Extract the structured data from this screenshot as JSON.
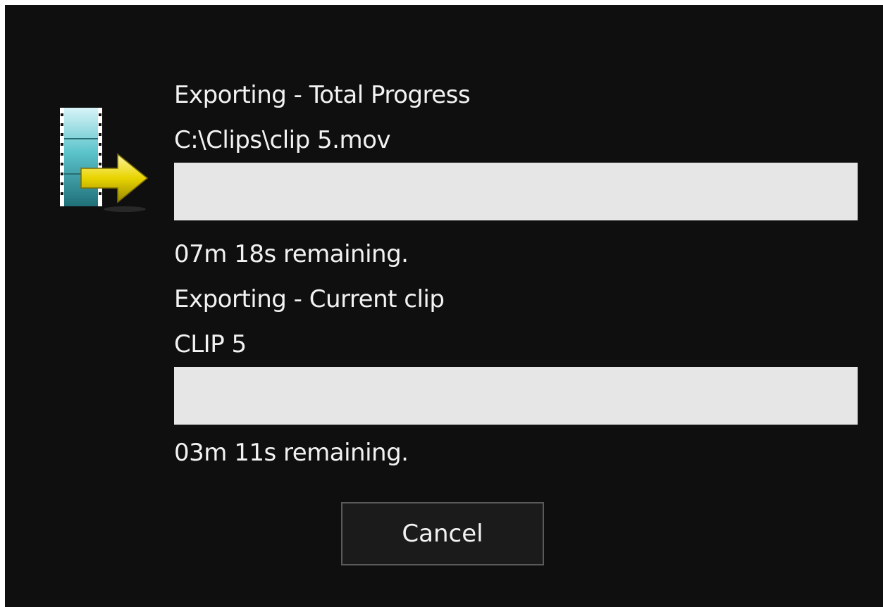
{
  "total": {
    "title": "Exporting - Total Progress",
    "file_path": "C:\\Clips\\clip 5.mov",
    "progress": 0,
    "remaining": "07m 18s remaining."
  },
  "current": {
    "title": "Exporting - Current clip",
    "clip_name": "CLIP 5",
    "progress": 0,
    "remaining": "03m 11s remaining."
  },
  "buttons": {
    "cancel_label": "Cancel"
  },
  "icon": {
    "name": "film-export-icon"
  },
  "colors": {
    "background": "#0f0f0f",
    "text": "#f2f2f2",
    "progress_track": "#e6e6e6",
    "film": "#3aa6b0",
    "arrow": "#e8d400"
  }
}
